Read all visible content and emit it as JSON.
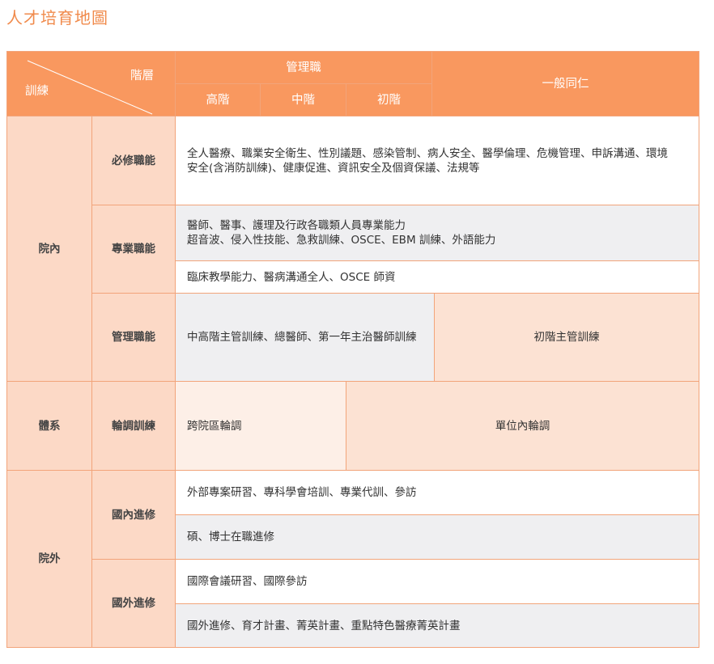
{
  "title": "人才培育地圖",
  "header": {
    "corner_level": "階層",
    "corner_training": "訓練",
    "management": "管理職",
    "levels": [
      "高階",
      "中階",
      "初階"
    ],
    "general_staff": "一般同仁"
  },
  "groups": {
    "internal": "院內",
    "system": "體系",
    "external": "院外"
  },
  "subgroups": {
    "required": "必修職能",
    "professional": "專業職能",
    "managerial": "管理職能",
    "rotation": "輪調訓練",
    "domestic": "國內進修",
    "overseas": "國外進修"
  },
  "cells": {
    "required_line1": "全人醫療、職業安全衛生、性別議題、感染管制、病人安全、醫學倫理、危機管理、申訴溝通、環境",
    "required_line2": "安全(含消防訓練)、健康促進、資訊安全及個資保議、法規等",
    "prof_a_line1": "醫師、醫事、護理及行政各職類人員專業能力",
    "prof_a_line2": "超音波、侵入性技能、急救訓練、OSCE、EBM 訓練、外語能力",
    "prof_b": "臨床教學能力、醫病溝通全人、OSCE 師資",
    "mgmt_upper": "中高階主管訓練、總醫師、第一年主治醫師訓練",
    "mgmt_junior": "初階主管訓練",
    "rotation_cross": "跨院區輪調",
    "rotation_unit": "單位內輪調",
    "domestic_a": "外部專案研習、專科學會培訓、專業代訓、參訪",
    "domestic_b": "碩、博士在職進修",
    "overseas_a": "國際會議研習、國際參訪",
    "overseas_b": "國外進修、育才計畫、菁英計畫、重點特色醫療菁英計畫"
  }
}
